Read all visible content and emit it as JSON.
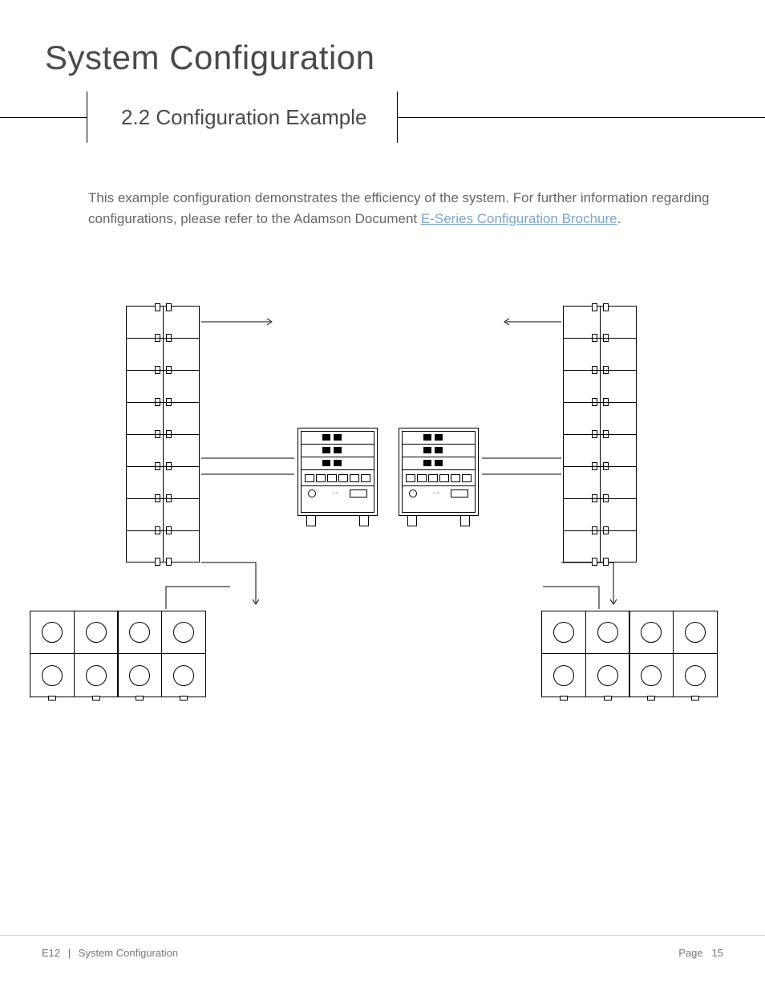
{
  "header": {
    "title": "System Configuration"
  },
  "section": {
    "number": "2.2",
    "name": "Configuration Example"
  },
  "body": {
    "intro": "This example configuration demonstrates the efficiency of the system.  For further information regarding configurations, please refer to the Adamson Document ",
    "link_text": "E-Series Configuration Brochure",
    "after_link": "."
  },
  "diagram": {
    "array_cabinets_per_side": 8,
    "amp_racks": 2,
    "amps_per_rack": 3,
    "sub_rows": 2,
    "sub_cells_per_row": 4
  },
  "footer": {
    "product": "E12",
    "section": "System Configuration",
    "page_label": "Page",
    "page_number": "15"
  }
}
